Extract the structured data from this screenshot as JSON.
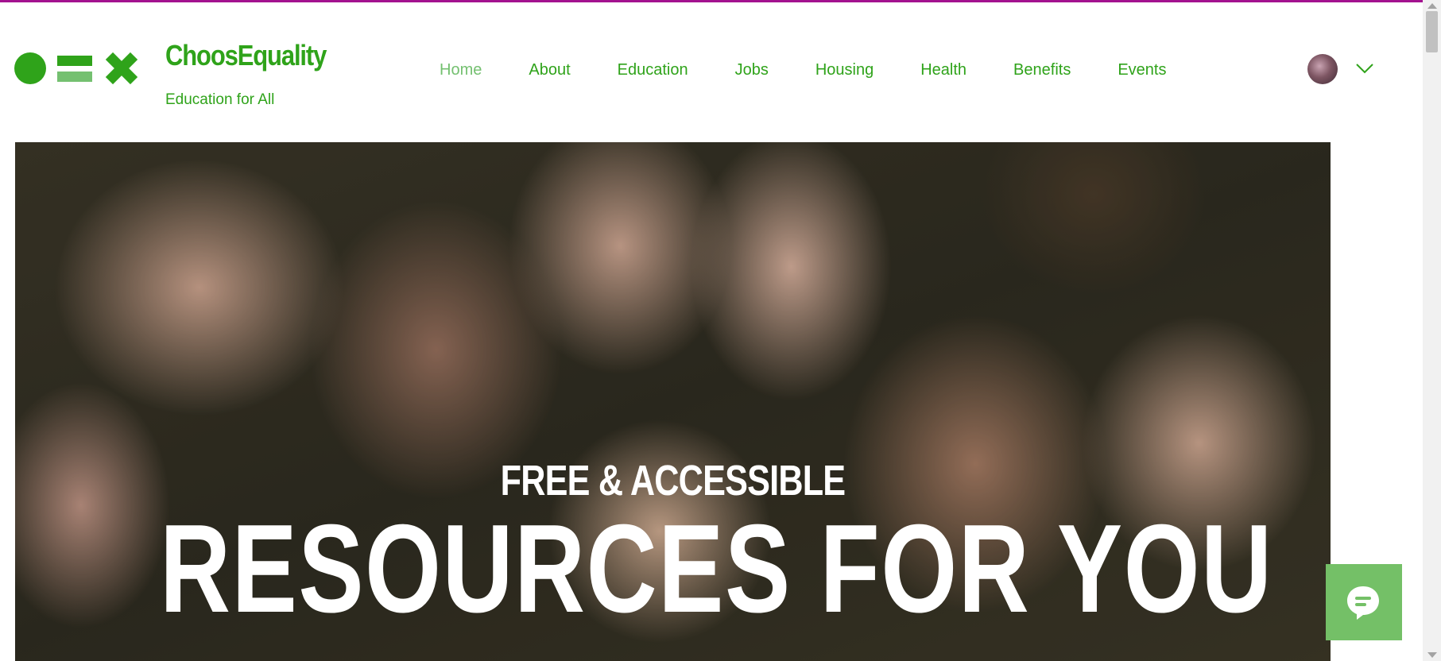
{
  "brand": {
    "title": "ChoosEquality",
    "subtitle": "Education for All"
  },
  "nav": {
    "items": [
      {
        "label": "Home",
        "active": true
      },
      {
        "label": "About"
      },
      {
        "label": "Education"
      },
      {
        "label": "Jobs"
      },
      {
        "label": "Housing"
      },
      {
        "label": "Health"
      },
      {
        "label": "Benefits"
      },
      {
        "label": "Events"
      }
    ]
  },
  "hero": {
    "subheading": "FREE & ACCESSIBLE",
    "heading": "RESOURCES FOR YOU"
  },
  "icons": {
    "logo": "circle-equals-times-logo",
    "account_menu": "chevron-down-icon",
    "chat": "chat-bubble-icon"
  },
  "colors": {
    "brand_green": "#2fa31a",
    "active_nav": "#74c070",
    "accent_bar": "#a3128f",
    "chat_button": "#74c067"
  }
}
